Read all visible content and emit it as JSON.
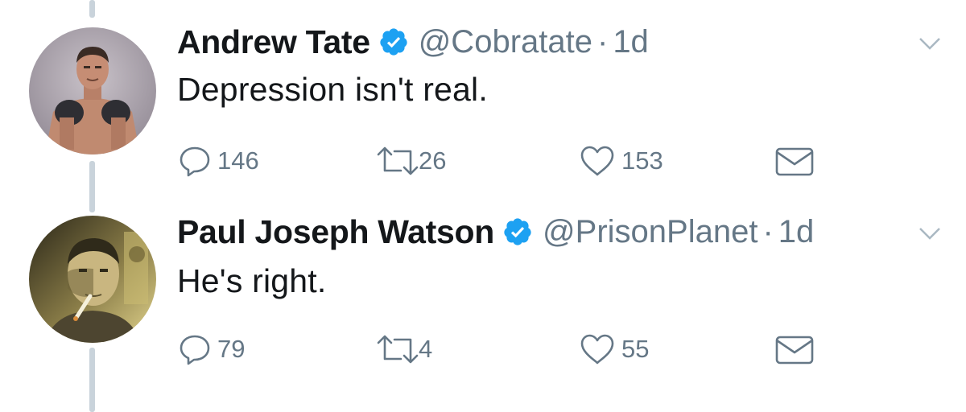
{
  "tweets": [
    {
      "display_name": "Andrew Tate",
      "handle": "@Cobratate",
      "separator": "·",
      "time": "1d",
      "text": "Depression isn't real.",
      "verified": true,
      "avatar_icon": "boxer-avatar",
      "counts": {
        "reply": "146",
        "retweet": "26",
        "like": "153"
      }
    },
    {
      "display_name": "Paul Joseph Watson",
      "handle": "@PrisonPlanet",
      "separator": "·",
      "time": "1d",
      "text": "He's right.",
      "verified": true,
      "avatar_icon": "smoking-man-avatar",
      "counts": {
        "reply": "79",
        "retweet": "4",
        "like": "55"
      }
    }
  ],
  "colors": {
    "text": "#14171a",
    "secondary": "#657786",
    "verified": "#1da1f2",
    "thread_line": "#c9d3db",
    "background": "#ffffff"
  },
  "icons": [
    "reply-icon",
    "retweet-icon",
    "like-icon",
    "direct-message-icon",
    "verified-badge-icon",
    "chevron-down-icon"
  ]
}
